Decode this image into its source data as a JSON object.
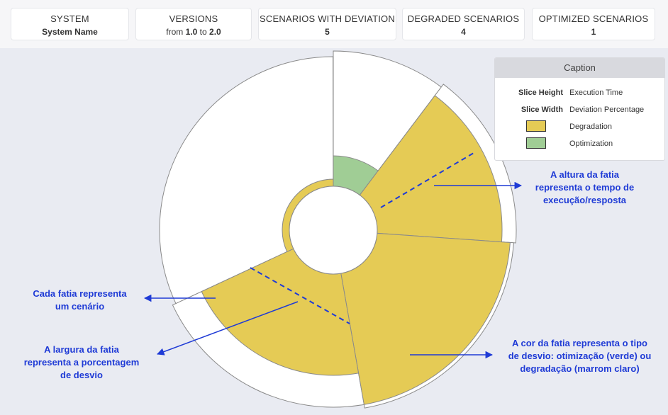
{
  "summary": {
    "system": {
      "label": "SYSTEM",
      "value": "System Name"
    },
    "versions": {
      "label": "VERSIONS",
      "prefix": "from",
      "from": "1.0",
      "mid": "to",
      "to": "2.0"
    },
    "scenarios_with_deviation": {
      "label": "SCENARIOS WITH DEVIATION",
      "value": "5"
    },
    "degraded_scenarios": {
      "label": "DEGRADED SCENARIOS",
      "value": "4"
    },
    "optimized_scenarios": {
      "label": "OPTIMIZED SCENARIOS",
      "value": "1"
    }
  },
  "caption": {
    "title": "Caption",
    "rows": [
      {
        "key": "Slice Height",
        "value": "Execution Time"
      },
      {
        "key": "Slice Width",
        "value": "Deviation Percentage"
      },
      {
        "swatch": "#e5cb55",
        "value": "Degradation"
      },
      {
        "swatch": "#a0cd95",
        "value": "Optimization"
      }
    ]
  },
  "colors": {
    "degradation": "#e5cb55",
    "optimization": "#a0cd95",
    "annotation": "#1f3bd6"
  },
  "annotations": {
    "height": [
      "A altura da fatia",
      "representa o tempo de",
      "execução/resposta"
    ],
    "scenario": [
      "Cada fatia representa",
      "um cenário"
    ],
    "width": [
      "A largura da fatia",
      "representa a porcentagem",
      "de desvio"
    ],
    "color": [
      "A cor da fatia representa o tipo",
      "de desvio: otimização (verde) ou",
      "degradação (marrom claro)"
    ]
  }
}
